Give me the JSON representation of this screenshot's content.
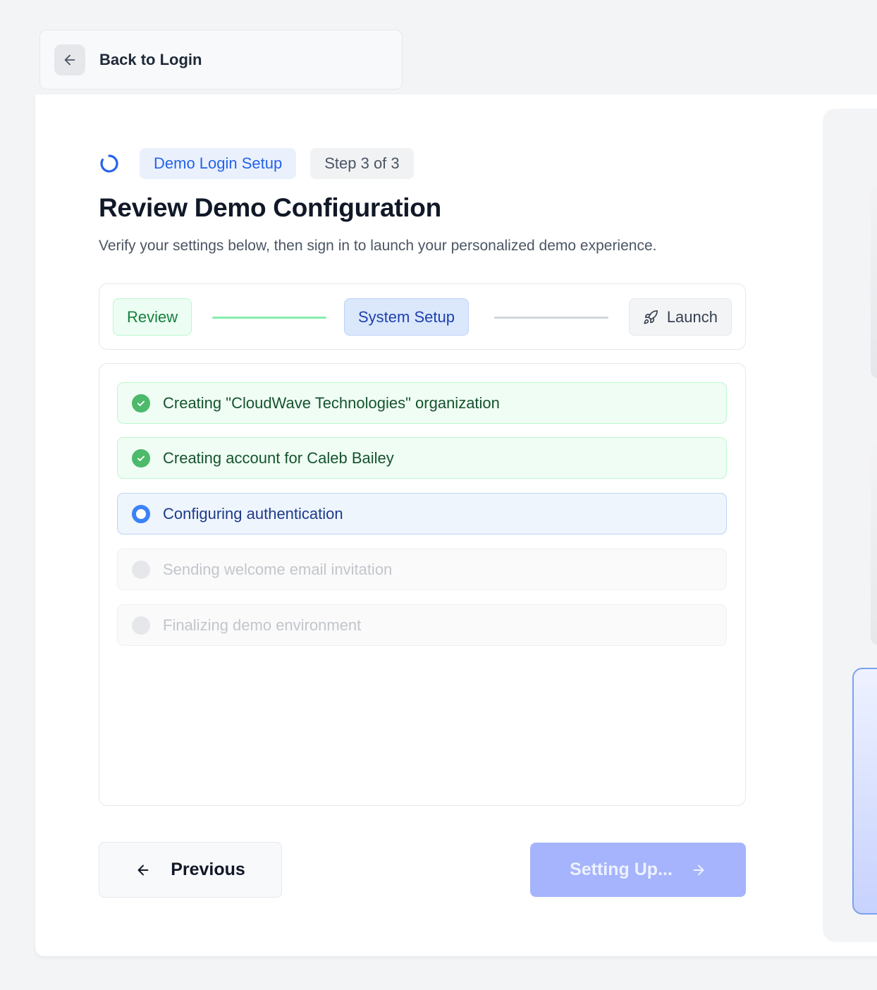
{
  "back": {
    "label": "Back to Login",
    "icon": "arrow-left-icon"
  },
  "header": {
    "badge": "Demo Login Setup",
    "step_indicator": "Step 3 of 3",
    "title": "Review Demo Configuration",
    "subtitle": "Verify your settings below, then sign in to launch your personalized demo experience."
  },
  "stepper": {
    "steps": [
      {
        "label": "Review",
        "state": "complete"
      },
      {
        "label": "System Setup",
        "state": "current"
      },
      {
        "label": "Launch",
        "state": "upcoming",
        "icon": "rocket-icon"
      }
    ]
  },
  "tasks": [
    {
      "label": "Creating \"CloudWave Technologies\" organization",
      "state": "done"
    },
    {
      "label": "Creating account for Caleb Bailey",
      "state": "done"
    },
    {
      "label": "Configuring authentication",
      "state": "active"
    },
    {
      "label": "Sending welcome email invitation",
      "state": "pending"
    },
    {
      "label": "Finalizing demo environment",
      "state": "pending"
    }
  ],
  "actions": {
    "previous_label": "Previous",
    "next_label": "Setting Up..."
  },
  "colors": {
    "accent": "#2563eb",
    "success": "#4cb96b",
    "active": "#3b82f6",
    "button_disabled": "#a5b4fc"
  }
}
